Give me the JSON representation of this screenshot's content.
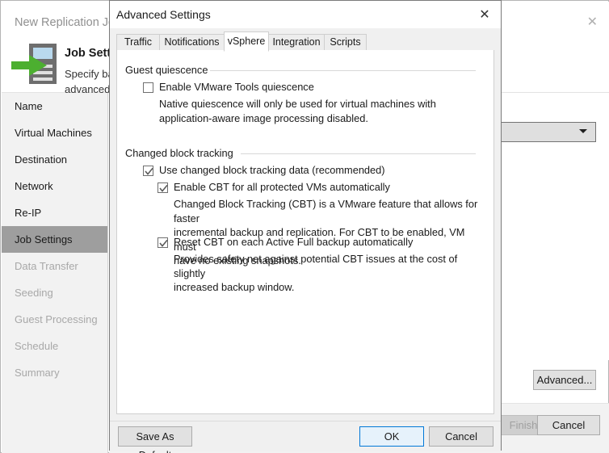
{
  "wizard": {
    "title": "New Replication Job",
    "close_label": "✕",
    "heading": "Job Settings",
    "subtitle_line1": "Specify backup repository to store replica metadata, replica naming policy, and customize",
    "subtitle_line2": "advanced job settings if required.",
    "sidebar": [
      {
        "label": "Name",
        "state": "enabled"
      },
      {
        "label": "Virtual Machines",
        "state": "enabled"
      },
      {
        "label": "Destination",
        "state": "enabled"
      },
      {
        "label": "Network",
        "state": "enabled"
      },
      {
        "label": "Re-IP",
        "state": "enabled"
      },
      {
        "label": "Job Settings",
        "state": "selected"
      },
      {
        "label": "Data Transfer",
        "state": "disabled"
      },
      {
        "label": "Seeding",
        "state": "disabled"
      },
      {
        "label": "Guest Processing",
        "state": "disabled"
      },
      {
        "label": "Schedule",
        "state": "disabled"
      },
      {
        "label": "Summary",
        "state": "disabled"
      }
    ],
    "advanced_button": "Advanced...",
    "finish_button": "Finish",
    "cancel_button": "Cancel"
  },
  "modal": {
    "title": "Advanced Settings",
    "close_label": "✕",
    "tabs": [
      {
        "label": "Traffic",
        "active": false
      },
      {
        "label": "Notifications",
        "active": false
      },
      {
        "label": "vSphere",
        "active": true
      },
      {
        "label": "Integration",
        "active": false
      },
      {
        "label": "Scripts",
        "active": false
      }
    ],
    "groups": [
      {
        "title": "Guest quiescence",
        "checkboxes": [
          {
            "label": "Enable VMware Tools quiescence",
            "checked": false,
            "description_line1": "Native quiescence will only be used for virtual machines with",
            "description_line2": "application-aware image processing disabled."
          }
        ]
      },
      {
        "title": "Changed block tracking",
        "checkboxes": [
          {
            "label": "Use changed block tracking data (recommended)",
            "checked": true,
            "description_line1": "",
            "description_line2": ""
          },
          {
            "label": "Enable CBT for all protected VMs automatically",
            "checked": true,
            "description_line1": "Changed Block Tracking (CBT) is a VMware feature that allows for faster",
            "description_line2": "incremental backup and replication. For CBT to be enabled, VM must",
            "description_line3": "have no existing snapshots."
          },
          {
            "label": "Reset CBT on each Active Full backup automatically",
            "checked": true,
            "description_line1": "Provides safety net against potential CBT issues at the cost of slightly",
            "description_line2": "increased backup window."
          }
        ]
      }
    ],
    "footer": {
      "save_as_default": "Save As Default",
      "ok": "OK",
      "cancel": "Cancel"
    }
  },
  "colors": {
    "accent": "#0078d7",
    "brand_green": "#4caf30",
    "selected_row": "#9e9e9e"
  }
}
